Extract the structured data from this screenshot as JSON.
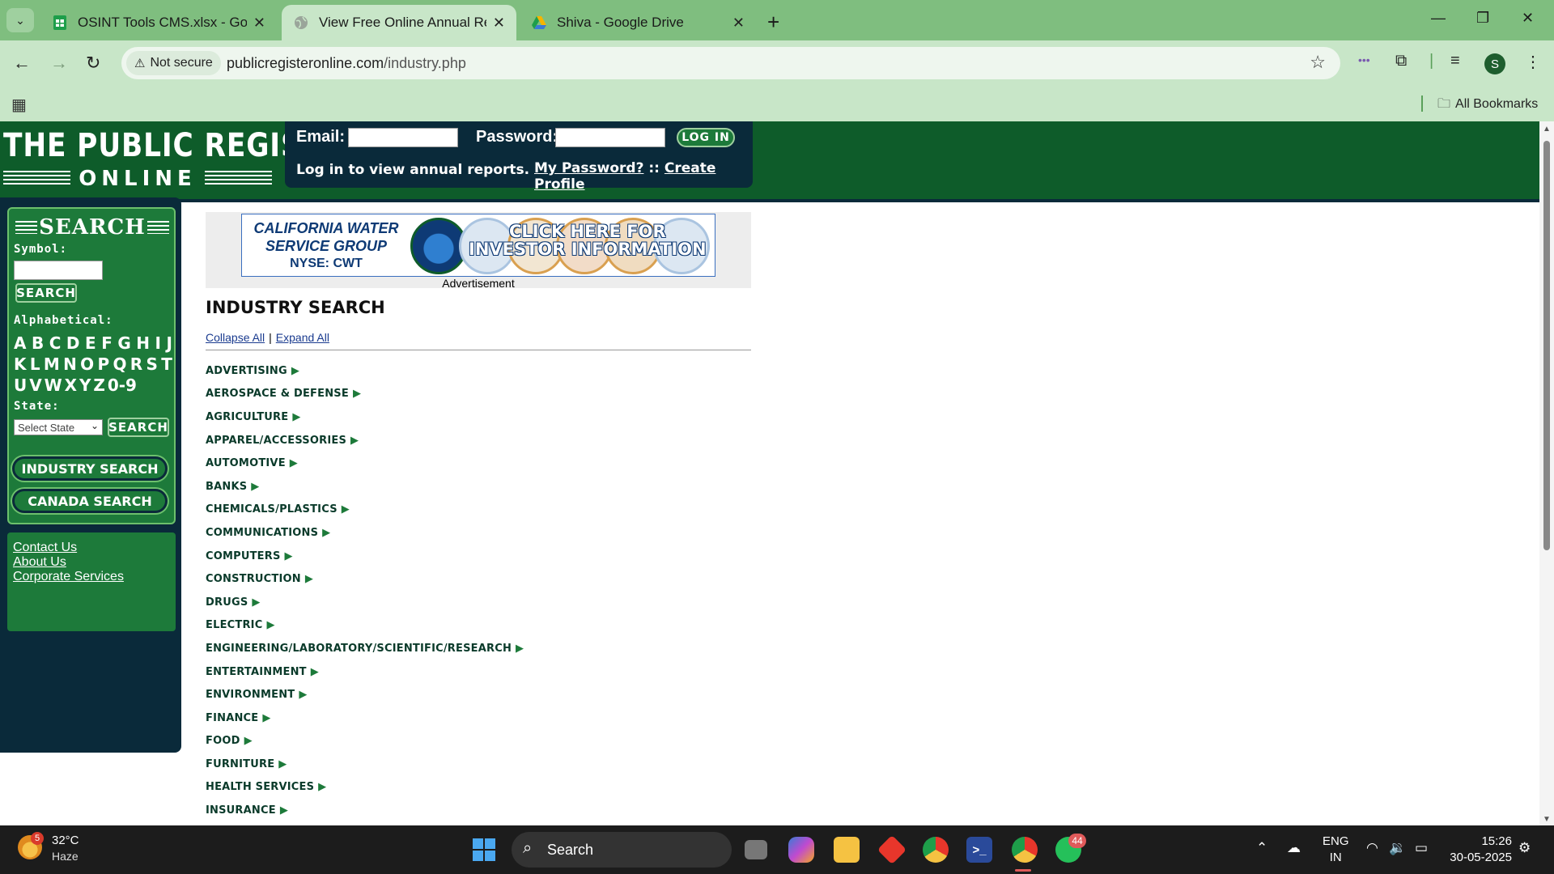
{
  "browser": {
    "tabs": [
      {
        "title": "OSINT Tools CMS.xlsx - Google",
        "icon": "sheets-icon",
        "active": false
      },
      {
        "title": "View Free Online Annual Repor",
        "icon": "globe-icon",
        "active": true
      },
      {
        "title": "Shiva - Google Drive",
        "icon": "drive-icon",
        "active": false
      }
    ],
    "security_label": "Not secure",
    "url_host": "publicregisteronline.com",
    "url_path": "/industry.php",
    "profile_initial": "S",
    "all_bookmarks": "All Bookmarks"
  },
  "site": {
    "logo_top": "THE PUBLIC REGISTER",
    "logo_bottom": "ONLINE",
    "login": {
      "email_label": "Email:",
      "password_label": "Password:",
      "login_button": "LOG IN",
      "message": "Log in to view annual reports.",
      "my_password": "My Password?",
      "separator": "::",
      "create_profile": "Create Profile"
    },
    "sidebar": {
      "search_title": "SEARCH",
      "symbol_label": "Symbol:",
      "search_button": "SEARCH",
      "alphabetical_label": "Alphabetical:",
      "letters_row1": [
        "A",
        "B",
        "C",
        "D",
        "E",
        "F",
        "G",
        "H",
        "I",
        "J"
      ],
      "letters_row2": [
        "K",
        "L",
        "M",
        "N",
        "O",
        "P",
        "Q",
        "R",
        "S",
        "T"
      ],
      "letters_row3": [
        "U",
        "V",
        "W",
        "X",
        "Y",
        "Z",
        "0-9"
      ],
      "state_label": "State:",
      "state_select": "Select State",
      "state_search_button": "SEARCH",
      "industry_search": "INDUSTRY SEARCH",
      "canada_search": "CANADA SEARCH",
      "links": [
        "Contact Us",
        "About Us",
        "Corporate Services"
      ]
    },
    "ad": {
      "company_line1": "CALIFORNIA WATER",
      "company_line2": "SERVICE GROUP",
      "ticker": "NYSE: CWT",
      "cta_line1": "CLICK HERE FOR",
      "cta_line2": "INVESTOR INFORMATION",
      "caption": "Advertisement"
    },
    "industry": {
      "title": "INDUSTRY SEARCH",
      "collapse_all": "Collapse All",
      "divider": "|",
      "expand_all": "Expand All",
      "items": [
        "ADVERTISING",
        "AEROSPACE & DEFENSE",
        "AGRICULTURE",
        "APPAREL/ACCESSORIES",
        "AUTOMOTIVE",
        "BANKS",
        "CHEMICALS/PLASTICS",
        "COMMUNICATIONS",
        "COMPUTERS",
        "CONSTRUCTION",
        "DRUGS",
        "ELECTRIC",
        "ENGINEERING/LABORATORY/SCIENTIFIC/RESEARCH",
        "ENTERTAINMENT",
        "ENVIRONMENT",
        "FINANCE",
        "FOOD",
        "FURNITURE",
        "HEALTH SERVICES",
        "INSURANCE"
      ]
    }
  },
  "taskbar": {
    "weather_badge": "5",
    "temperature": "32°C",
    "weather": "Haze",
    "search_label": "Search",
    "whatsapp_badge": "44",
    "language_line1": "ENG",
    "language_line2": "IN",
    "time": "15:26",
    "date": "30-05-2025"
  }
}
